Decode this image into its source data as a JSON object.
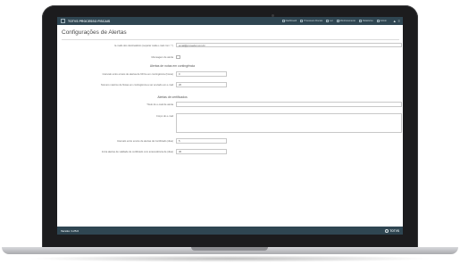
{
  "app": {
    "title": "TOTVS PROCESSO FISCAIS",
    "menu": [
      {
        "label": "Dashboard",
        "icon": "dashboard-icon"
      },
      {
        "label": "Processos Fiscais",
        "icon": "document-icon"
      },
      {
        "label": "Lei",
        "icon": "scale-icon"
      },
      {
        "label": "Monitoramento",
        "icon": "monitor-icon"
      },
      {
        "label": "Relatórios",
        "icon": "report-icon"
      },
      {
        "label": "Admin",
        "icon": "gear-icon"
      }
    ],
    "toolbar_icons": [
      "user-icon",
      "menu-icon"
    ]
  },
  "page": {
    "title": "Configurações de Alertas"
  },
  "form": {
    "email_label": "E-mails dos destinatários (separar cada e-mail com \";\")",
    "email_value": "email@provedor.com.br",
    "poll_label": "Mensagem de alerta",
    "section_contingency": "Alertas de notas em contingência",
    "contingency_minutes_label": "Intervalo entre envios de alertas de NFCe em contingência (horas)",
    "contingency_minutes_value": "0",
    "contingency_max_label": "Número máximo de Notas em contingência a ser enviado em e-mail",
    "contingency_max_value": "20",
    "section_certificates": "Alertas de certificados",
    "cert_subject_label": "Título do e-mail de alerta",
    "cert_subject_value": "",
    "cert_body_label": "Corpo do e-mail",
    "cert_body_value": "",
    "cert_interval_label": "Intervalo entre envios de alertas de Certificado (dias)",
    "cert_interval_value": "5",
    "cert_days_label": "Inicia alertas de validade de certificado com antecedência de (dias)",
    "cert_days_value": "30"
  },
  "footer": {
    "version": "Versão: 1.25.0",
    "brand": "TOTVS"
  },
  "colors": {
    "topbar": "#2f4652",
    "bezel": "#1c1c1e"
  }
}
